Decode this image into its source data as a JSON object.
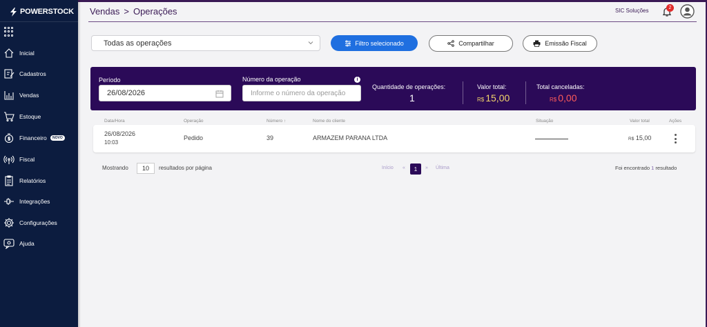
{
  "app": {
    "brand": "POWERSTOCK"
  },
  "sidebar": {
    "items": [
      {
        "label": "Inicial",
        "icon": "home-icon"
      },
      {
        "label": "Cadastros",
        "icon": "edit-icon"
      },
      {
        "label": "Vendas",
        "icon": "chart-icon"
      },
      {
        "label": "Estoque",
        "icon": "cart-icon"
      },
      {
        "label": "Financeiro",
        "icon": "dollar-icon",
        "badge": "NOVO"
      },
      {
        "label": "Fiscal",
        "icon": "antenna-icon"
      },
      {
        "label": "Relatórios",
        "icon": "report-icon"
      },
      {
        "label": "Integrações",
        "icon": "plug-icon"
      },
      {
        "label": "Configurações",
        "icon": "gear-icon"
      },
      {
        "label": "Ajuda",
        "icon": "help-icon"
      }
    ]
  },
  "header": {
    "breadcrumb": [
      "Vendas",
      ">",
      "Operações"
    ],
    "company": "SIC Soluções",
    "notifications": "2"
  },
  "toolbar": {
    "operation_filter": "Todas as operações",
    "filter_button": "Filtro selecionado",
    "share_button": "Compartilhar",
    "fiscal_button": "Emissão Fiscal"
  },
  "summary": {
    "period_label": "Período",
    "period_value": "26/08/2026",
    "op_number_label": "Número da operação",
    "op_number_placeholder": "Informe o número da operação",
    "info_glyph": "i",
    "quantity_label": "Quantidade de operações:",
    "quantity_value": "1",
    "total_label": "Valor total:",
    "total_currency": "R$",
    "total_value": "15,00",
    "canceled_label": "Total canceladas:",
    "canceled_currency": "R$",
    "canceled_value": "0,00"
  },
  "table": {
    "columns": [
      "Data/Hora",
      "Operação",
      "Número",
      "Nome do cliente",
      "Situação",
      "Valor total",
      "Ações"
    ],
    "sort_indicator": "↑",
    "rows": [
      {
        "date": "26/08/2026",
        "time": "10:03",
        "operation": "Pedido",
        "number": "39",
        "client": "ARMAZEM PARANA LTDA",
        "currency": "R$",
        "total": "15,00"
      }
    ]
  },
  "footer": {
    "showing_label": "Mostrando",
    "page_size": "10",
    "per_page_label": "resultados por página",
    "first_label": "Início",
    "prev_symbol": "«",
    "current_page": "1",
    "next_symbol": "»",
    "last_label": "Última",
    "result_prefix": "Foi encontrado",
    "result_count": "1",
    "result_suffix": "resultado"
  },
  "colors": {
    "sidebar": "#0c1c3f",
    "panel": "#2b0a58",
    "primary": "#1f6fe0",
    "accent_total": "#f2d36b",
    "accent_canceled": "#ff5a5a"
  }
}
